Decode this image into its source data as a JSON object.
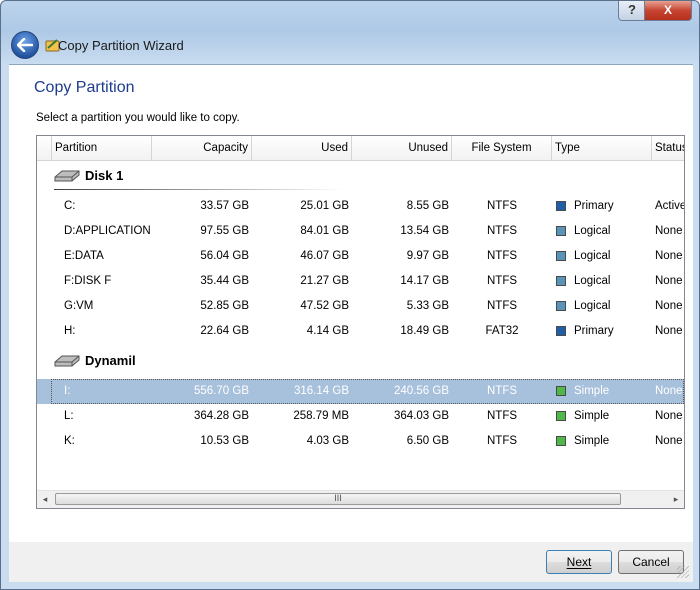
{
  "window": {
    "title": "Copy Partition Wizard",
    "help_glyph": "?",
    "close_glyph": "X"
  },
  "page": {
    "title": "Copy Partition",
    "instruction": "Select a partition you would like to copy."
  },
  "columns": [
    "Partition",
    "Capacity",
    "Used",
    "Unused",
    "File System",
    "Type",
    "Status"
  ],
  "disks": [
    {
      "name": "Disk 1",
      "partitions": [
        {
          "partition": "C:",
          "capacity": "33.57 GB",
          "used": "25.01 GB",
          "unused": "8.55 GB",
          "fs": "NTFS",
          "type": "Primary",
          "status": "Active",
          "color": "#1f5fa8"
        },
        {
          "partition": "D:APPLICATION",
          "capacity": "97.55 GB",
          "used": "84.01 GB",
          "unused": "13.54 GB",
          "fs": "NTFS",
          "type": "Logical",
          "status": "None",
          "color": "#5a93b8"
        },
        {
          "partition": "E:DATA",
          "capacity": "56.04 GB",
          "used": "46.07 GB",
          "unused": "9.97 GB",
          "fs": "NTFS",
          "type": "Logical",
          "status": "None",
          "color": "#5a93b8"
        },
        {
          "partition": "F:DISK F",
          "capacity": "35.44 GB",
          "used": "21.27 GB",
          "unused": "14.17 GB",
          "fs": "NTFS",
          "type": "Logical",
          "status": "None",
          "color": "#5a93b8"
        },
        {
          "partition": "G:VM",
          "capacity": "52.85 GB",
          "used": "47.52 GB",
          "unused": "5.33 GB",
          "fs": "NTFS",
          "type": "Logical",
          "status": "None",
          "color": "#5a93b8"
        },
        {
          "partition": "H:",
          "capacity": "22.64 GB",
          "used": "4.14 GB",
          "unused": "18.49 GB",
          "fs": "FAT32",
          "type": "Primary",
          "status": "None",
          "color": "#1f5fa8"
        }
      ]
    },
    {
      "name": "Dynamil",
      "partitions": [
        {
          "partition": "I:",
          "capacity": "556.70 GB",
          "used": "316.14 GB",
          "unused": "240.56 GB",
          "fs": "NTFS",
          "type": "Simple",
          "status": "None",
          "color": "#4fb848",
          "selected": true
        },
        {
          "partition": "L:",
          "capacity": "364.28 GB",
          "used": "258.79 MB",
          "unused": "364.03 GB",
          "fs": "NTFS",
          "type": "Simple",
          "status": "None",
          "color": "#4fb848"
        },
        {
          "partition": "K:",
          "capacity": "10.53 GB",
          "used": "4.03 GB",
          "unused": "6.50 GB",
          "fs": "NTFS",
          "type": "Simple",
          "status": "None",
          "color": "#4fb848"
        }
      ]
    }
  ],
  "scrollbar": {
    "left_arrow": "◂",
    "right_arrow": "▸",
    "grip": "III"
  },
  "buttons": {
    "next": "Next",
    "cancel": "Cancel"
  }
}
